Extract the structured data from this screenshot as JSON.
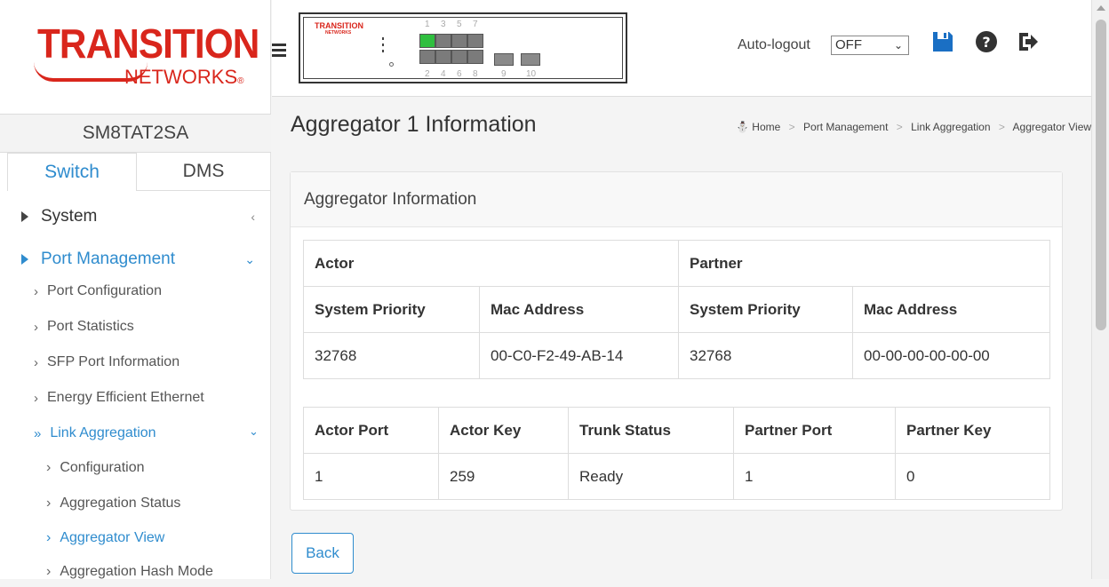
{
  "logo": {
    "top": "TRANSITION",
    "bottom": "NETWORKS",
    "reg": "®"
  },
  "device_name": "SM8TAT2SA",
  "tabs": {
    "switch": "Switch",
    "dms": "DMS"
  },
  "nav": {
    "system": "System",
    "port_management": "Port Management",
    "items": [
      "Port Configuration",
      "Port Statistics",
      "SFP Port Information",
      "Energy Efficient Ethernet"
    ],
    "link_aggregation": "Link Aggregation",
    "la_items": [
      "Configuration",
      "Aggregation Status",
      "Aggregator View",
      "Aggregation Hash Mode"
    ]
  },
  "panel": {
    "brand": "TRANSITION",
    "brand_sub": "NETWORKS",
    "top_nums": [
      "1",
      "3",
      "5",
      "7"
    ],
    "bottom_nums": [
      "2",
      "4",
      "6",
      "8"
    ],
    "sfp_nums": [
      "9",
      "10"
    ]
  },
  "topbar": {
    "autologout_label": "Auto-logout",
    "autologout_value": "OFF"
  },
  "page_title": "Aggregator 1 Information",
  "breadcrumb": [
    "Home",
    "Port Management",
    "Link Aggregation",
    "Aggregator View"
  ],
  "card_title": "Aggregator Information",
  "table1": {
    "actor": "Actor",
    "partner": "Partner",
    "headers": [
      "System Priority",
      "Mac Address",
      "System Priority",
      "Mac Address"
    ],
    "row": [
      "32768",
      "00-C0-F2-49-AB-14",
      "32768",
      "00-00-00-00-00-00"
    ]
  },
  "table2": {
    "headers": [
      "Actor Port",
      "Actor Key",
      "Trunk Status",
      "Partner Port",
      "Partner Key"
    ],
    "row": [
      "1",
      "259",
      "Ready",
      "1",
      "0"
    ]
  },
  "back_label": "Back",
  "colors": {
    "accent": "#2f8cce",
    "brand_red": "#d9261c",
    "port_up": "#2fbf3f"
  },
  "icons": [
    "menu-icon",
    "save-icon",
    "help-icon",
    "logout-icon"
  ]
}
